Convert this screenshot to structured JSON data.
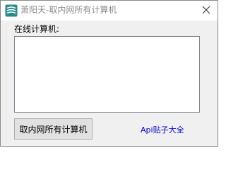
{
  "window": {
    "title": "萧阳天-取内网所有计算机",
    "close_icon": "close-icon",
    "app_icon": "app-logo-icon"
  },
  "main": {
    "computers_label": "在线计算机:",
    "computer_list_value": "",
    "fetch_button_label": "取内网所有计算机",
    "api_link_label": "Api贴子大全"
  },
  "colors": {
    "title_text": "#8c8c8c",
    "link": "#0000cc",
    "app_icon": "#2b8a8a",
    "window_bg": "#f0f0f0"
  }
}
